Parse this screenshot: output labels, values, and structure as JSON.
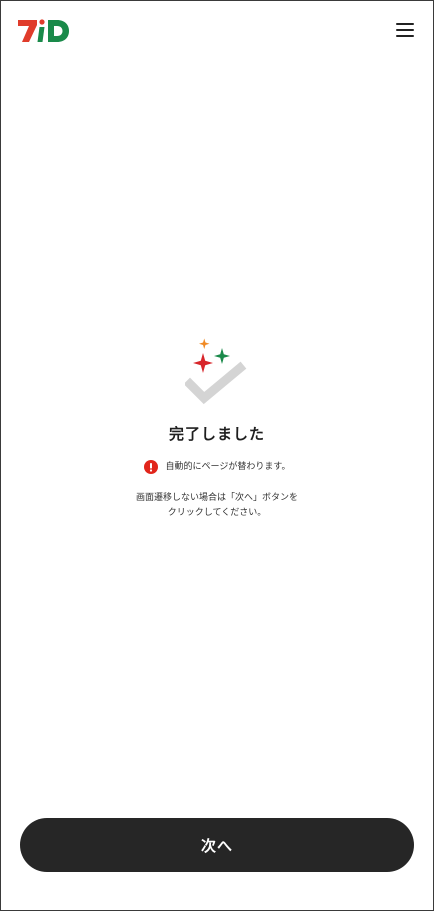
{
  "header": {
    "logo_text": "7iD",
    "menu_icon": "hamburger-menu-icon"
  },
  "completion": {
    "icon": "sparkle-check-icon",
    "title": "完了しました",
    "notice_icon": "exclamation-alert-icon",
    "notice_text": "自動的にページが替わります。",
    "hint_line1": "画面遷移しない場合は「次へ」ボタンを",
    "hint_line2": "クリックしてください。"
  },
  "footer": {
    "next_label": "次へ"
  },
  "colors": {
    "logo_red": "#e03c2b",
    "logo_green": "#1a8a4a",
    "sparkle_orange": "#f08a24",
    "sparkle_red": "#d8262b",
    "sparkle_green": "#1a8a4a",
    "check_gray": "#d4d4d4",
    "alert_red": "#e1251b",
    "button_bg": "#262626"
  }
}
